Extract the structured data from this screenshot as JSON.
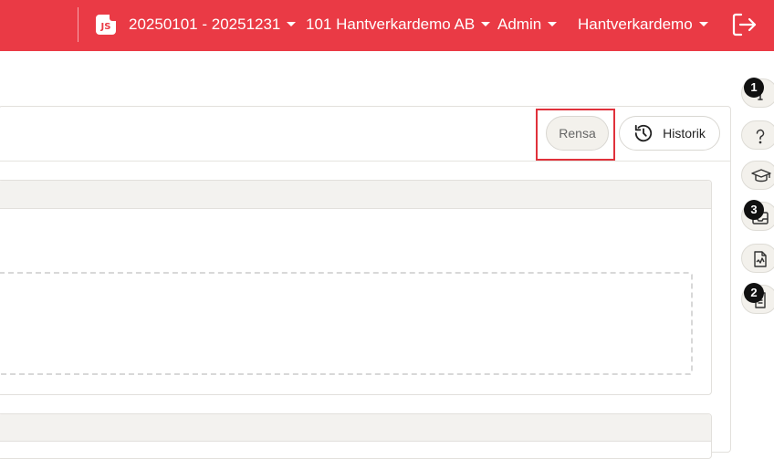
{
  "topbar": {
    "badge_text": "JS",
    "period": "20250101 - 20251231",
    "company": "101 Hantverkardemo AB",
    "role": "Admin",
    "user": "Hantverkardemo",
    "accent_color": "#ea3a45"
  },
  "toolbar": {
    "clear_label": "Rensa",
    "history_label": "Historik"
  },
  "rail": {
    "items": [
      {
        "icon": "info-icon",
        "badge": "1"
      },
      {
        "icon": "help-icon",
        "badge": ""
      },
      {
        "icon": "graduation-cap-icon",
        "badge": ""
      },
      {
        "icon": "inbox-icon",
        "badge": "3"
      },
      {
        "icon": "document-chart-icon",
        "badge": ""
      },
      {
        "icon": "document-list-icon",
        "badge": "2"
      }
    ]
  }
}
